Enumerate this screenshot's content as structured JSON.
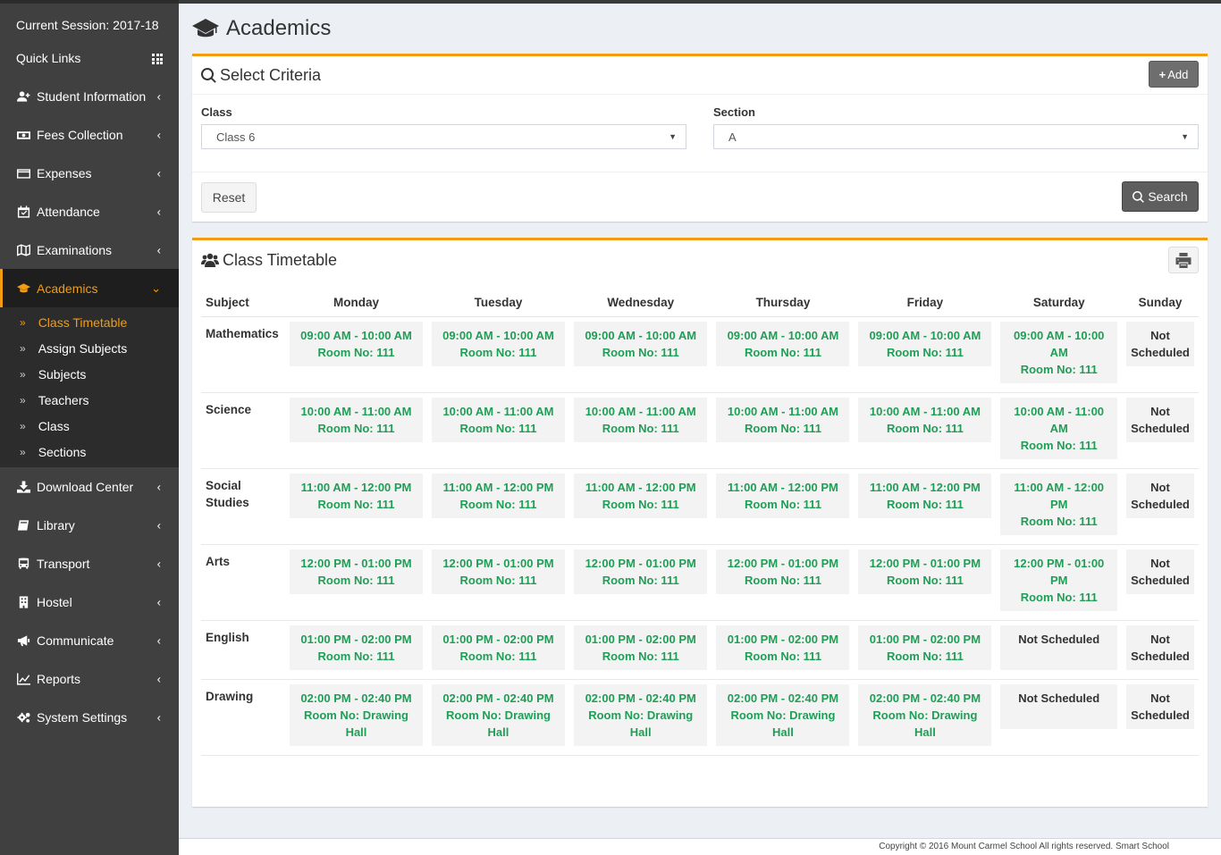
{
  "sidebar": {
    "session": "Current Session: 2017-18",
    "quick_links": "Quick Links",
    "items": [
      {
        "label": "Student Information",
        "icon": "user-plus-icon"
      },
      {
        "label": "Fees Collection",
        "icon": "money-icon"
      },
      {
        "label": "Expenses",
        "icon": "credit-card-icon"
      },
      {
        "label": "Attendance",
        "icon": "calendar-check-icon"
      },
      {
        "label": "Examinations",
        "icon": "map-icon"
      },
      {
        "label": "Academics",
        "icon": "graduation-cap-icon"
      },
      {
        "label": "Download Center",
        "icon": "download-icon"
      },
      {
        "label": "Library",
        "icon": "book-icon"
      },
      {
        "label": "Transport",
        "icon": "bus-icon"
      },
      {
        "label": "Hostel",
        "icon": "building-icon"
      },
      {
        "label": "Communicate",
        "icon": "bullhorn-icon"
      },
      {
        "label": "Reports",
        "icon": "line-chart-icon"
      },
      {
        "label": "System Settings",
        "icon": "gears-icon"
      }
    ],
    "academics_sub": [
      "Class Timetable",
      "Assign Subjects",
      "Subjects",
      "Teachers",
      "Class",
      "Sections"
    ]
  },
  "page": {
    "title": "Academics"
  },
  "criteria": {
    "title": "Select Criteria",
    "add_label": "Add",
    "class_label": "Class",
    "class_value": "Class 6",
    "section_label": "Section",
    "section_value": "A",
    "reset_label": "Reset",
    "search_label": "Search"
  },
  "timetable": {
    "title": "Class Timetable",
    "headers": [
      "Subject",
      "Monday",
      "Tuesday",
      "Wednesday",
      "Thursday",
      "Friday",
      "Saturday",
      "Sunday"
    ],
    "rows": [
      {
        "subject": "Mathematics",
        "cells": [
          "09:00 AM - 10:00 AM\nRoom No: 111",
          "09:00 AM - 10:00 AM\nRoom No: 111",
          "09:00 AM - 10:00 AM\nRoom No: 111",
          "09:00 AM - 10:00 AM\nRoom No: 111",
          "09:00 AM - 10:00 AM\nRoom No: 111",
          "09:00 AM - 10:00 AM\nRoom No: 111",
          "Not Scheduled"
        ]
      },
      {
        "subject": "Science",
        "cells": [
          "10:00 AM - 11:00 AM\nRoom No: 111",
          "10:00 AM - 11:00 AM\nRoom No: 111",
          "10:00 AM - 11:00 AM\nRoom No: 111",
          "10:00 AM - 11:00 AM\nRoom No: 111",
          "10:00 AM - 11:00 AM\nRoom No: 111",
          "10:00 AM - 11:00 AM\nRoom No: 111",
          "Not Scheduled"
        ]
      },
      {
        "subject": "Social Studies",
        "cells": [
          "11:00 AM - 12:00 PM\nRoom No: 111",
          "11:00 AM - 12:00 PM\nRoom No: 111",
          "11:00 AM - 12:00 PM\nRoom No: 111",
          "11:00 AM - 12:00 PM\nRoom No: 111",
          "11:00 AM - 12:00 PM\nRoom No: 111",
          "11:00 AM - 12:00 PM\nRoom No: 111",
          "Not Scheduled"
        ]
      },
      {
        "subject": "Arts",
        "cells": [
          "12:00 PM - 01:00 PM\nRoom No: 111",
          "12:00 PM - 01:00 PM\nRoom No: 111",
          "12:00 PM - 01:00 PM\nRoom No: 111",
          "12:00 PM - 01:00 PM\nRoom No: 111",
          "12:00 PM - 01:00 PM\nRoom No: 111",
          "12:00 PM - 01:00 PM\nRoom No: 111",
          "Not Scheduled"
        ]
      },
      {
        "subject": "English",
        "cells": [
          "01:00 PM - 02:00 PM\nRoom No: 111",
          "01:00 PM - 02:00 PM\nRoom No: 111",
          "01:00 PM - 02:00 PM\nRoom No: 111",
          "01:00 PM - 02:00 PM\nRoom No: 111",
          "01:00 PM - 02:00 PM\nRoom No: 111",
          "Not Scheduled",
          "Not Scheduled"
        ]
      },
      {
        "subject": "Drawing",
        "cells": [
          "02:00 PM - 02:40 PM\nRoom No: Drawing Hall",
          "02:00 PM - 02:40 PM\nRoom No: Drawing Hall",
          "02:00 PM - 02:40 PM\nRoom No: Drawing Hall",
          "02:00 PM - 02:40 PM\nRoom No: Drawing Hall",
          "02:00 PM - 02:40 PM\nRoom No: Drawing Hall",
          "Not Scheduled",
          "Not Scheduled"
        ]
      }
    ]
  },
  "footer": {
    "text": "Copyright © 2016 Mount Carmel School All rights reserved. Smart School"
  },
  "colors": {
    "accent": "#f39c12",
    "slot_text": "#1f9e55",
    "sidebar_bg": "#404040"
  }
}
